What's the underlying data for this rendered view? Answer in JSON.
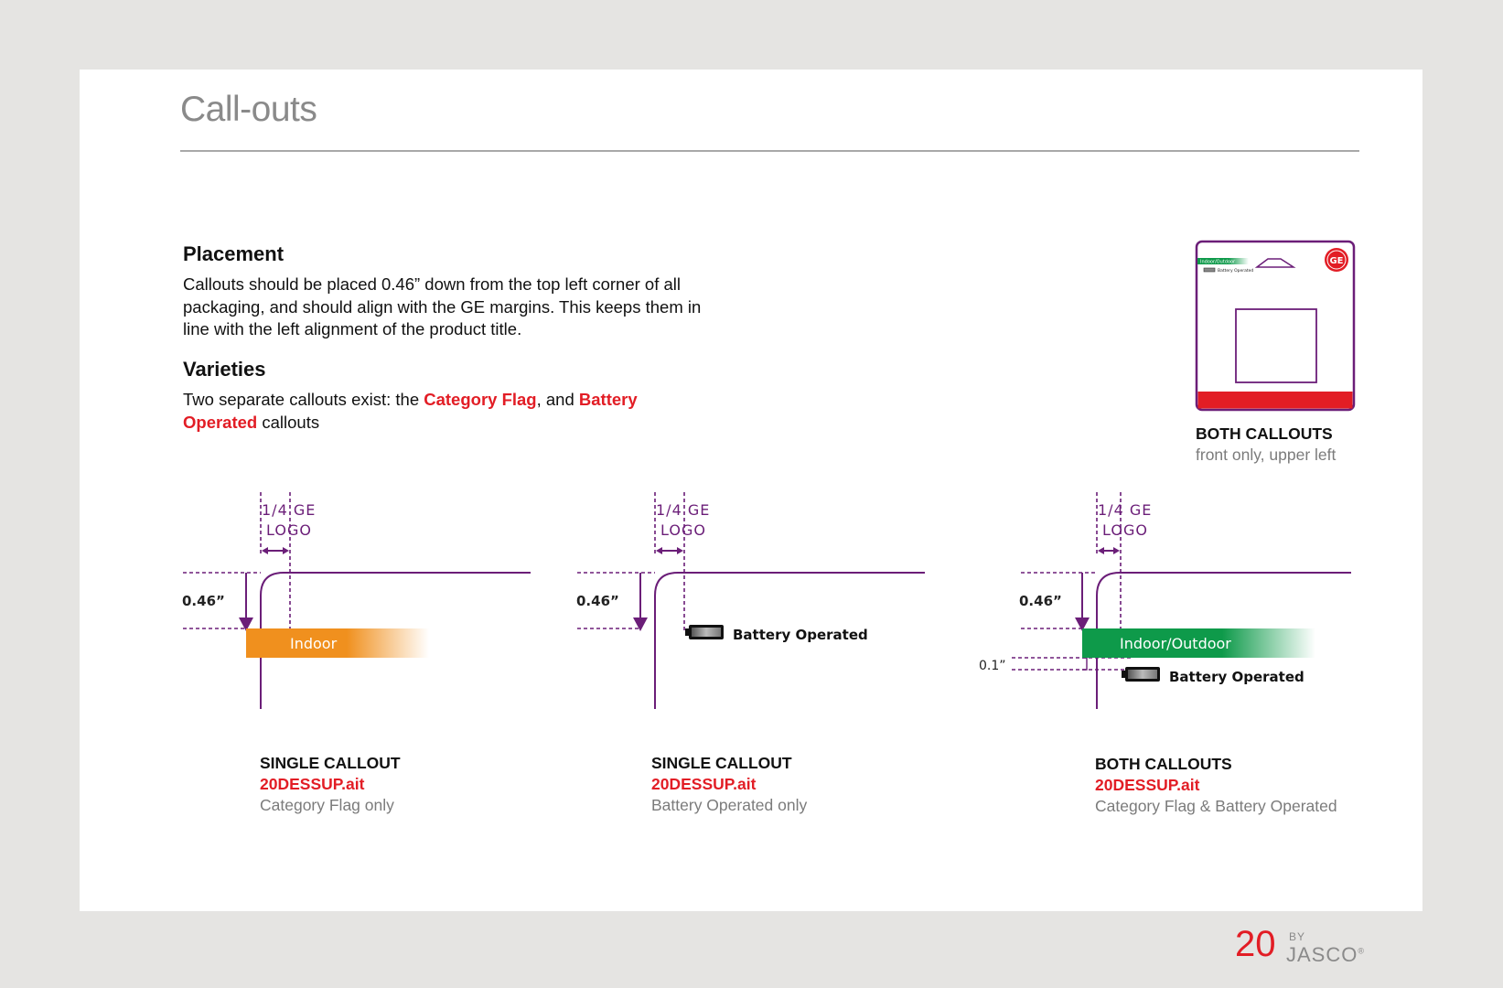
{
  "page": {
    "title": "Call-outs"
  },
  "placement": {
    "heading": "Placement",
    "text": "Callouts should be placed 0.46” down from the top left corner of all packaging, and should align with the GE margins. This keeps them in line with the left alignment of the product title."
  },
  "varieties": {
    "heading": "Varieties",
    "text_before": "Two separate callouts exist: the ",
    "highlight_1": "Category Flag",
    "text_middle": ", and ",
    "highlight_2": "Battery Operated",
    "text_after": " callouts"
  },
  "package_preview": {
    "flag_label": "Indoor/Outdoor",
    "battery_label": "Battery Operated",
    "logo_text": "GE",
    "caption_title": "BOTH CALLOUTS",
    "caption_sub": "front only, upper left"
  },
  "diagrams": [
    {
      "logo_label_1": "1/4 GE",
      "logo_label_2": "LOGO",
      "offset_label": "0.46”",
      "flag_label": "Indoor",
      "caption_title": "SINGLE CALLOUT",
      "caption_file": "20DESSUP.ait",
      "caption_sub": "Category Flag only"
    },
    {
      "logo_label_1": "1/4 GE",
      "logo_label_2": "LOGO",
      "offset_label": "0.46”",
      "battery_label": "Battery Operated",
      "caption_title": "SINGLE CALLOUT",
      "caption_file": "20DESSUP.ait",
      "caption_sub": "Battery Operated only"
    },
    {
      "logo_label_1": "1/4 GE",
      "logo_label_2": "LOGO",
      "offset_label": "0.46”",
      "gap_label": "0.1”",
      "flag_label": "Indoor/Outdoor",
      "battery_label": "Battery Operated",
      "caption_title": "BOTH CALLOUTS",
      "caption_file": "20DESSUP.ait",
      "caption_sub": "Category Flag & Battery Operated"
    }
  ],
  "footer": {
    "page_number": "20",
    "by": "BY",
    "brand": "JASCO",
    "trademark": "®"
  },
  "colors": {
    "accent_red": "#e21d25",
    "guide_purple": "#6b1e78",
    "indoor_orange": "#f0901e",
    "outdoor_green": "#0e9a4a"
  }
}
